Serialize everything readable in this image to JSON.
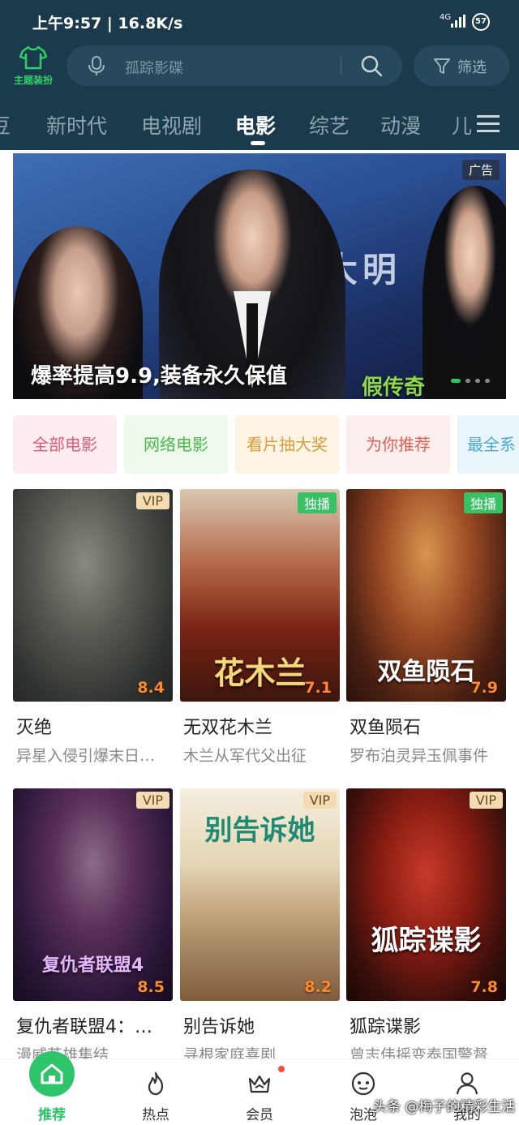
{
  "status_bar": {
    "time": "上午9:57 | 16.8K/s",
    "network": "4G",
    "battery": "57"
  },
  "header": {
    "theme_label": "主题装扮",
    "search_placeholder": "孤踪影碟",
    "filter_label": "筛选"
  },
  "tabs": [
    {
      "label": "豆"
    },
    {
      "label": "新时代"
    },
    {
      "label": "电视剧"
    },
    {
      "label": "电影",
      "active": true
    },
    {
      "label": "综艺"
    },
    {
      "label": "动漫"
    },
    {
      "label": "儿"
    }
  ],
  "banner": {
    "ad_label": "广告",
    "bg_text": "五大明",
    "caption": "爆率提高9.9,装备永久保值",
    "sub_caption": "假传奇"
  },
  "chips": [
    {
      "label": "全部电影",
      "color": "#e25b74"
    },
    {
      "label": "网络电影",
      "color": "#4cb64f"
    },
    {
      "label": "看片抽大奖",
      "color": "#d99d3a"
    },
    {
      "label": "为你推荐",
      "color": "#e35f55"
    },
    {
      "label": "最全系",
      "color": "#4da7d6"
    }
  ],
  "movies": [
    {
      "title": "灭绝",
      "desc": "异星入侵引爆末日…",
      "badge": "VIP",
      "score": "8.4",
      "poster_text": ""
    },
    {
      "title": "无双花木兰",
      "desc": "木兰从军代父出征",
      "badge": "独播",
      "score": "7.1",
      "poster_text": "花木兰"
    },
    {
      "title": "双鱼陨石",
      "desc": "罗布泊灵异玉佩事件",
      "badge": "独播",
      "score": "7.9",
      "poster_text": "双鱼陨石"
    },
    {
      "title": "复仇者联盟4：…",
      "desc": "漫威英雄集结",
      "badge": "VIP",
      "score": "8.5",
      "poster_text": "复仇者联盟4"
    },
    {
      "title": "别告诉她",
      "desc": "寻根家庭喜剧",
      "badge": "VIP",
      "score": "8.2",
      "poster_text": "别告诉她"
    },
    {
      "title": "狐踪谍影",
      "desc": "曾志伟摇变泰国警督",
      "badge": "VIP",
      "score": "7.8",
      "poster_text": "狐踪谍影"
    }
  ],
  "bottom_nav": [
    {
      "label": "推荐",
      "icon": "home-icon",
      "active": true
    },
    {
      "label": "热点",
      "icon": "flame-icon"
    },
    {
      "label": "会员",
      "icon": "crown-icon"
    },
    {
      "label": "泡泡",
      "icon": "bubble-face-icon"
    },
    {
      "label": "我的",
      "icon": "user-icon"
    }
  ],
  "watermark": "头条 @梅子的精彩生活",
  "colors": {
    "accent": "#2dc46a",
    "header_bg": "#1b3a4b",
    "score": "#ff8a2a"
  }
}
